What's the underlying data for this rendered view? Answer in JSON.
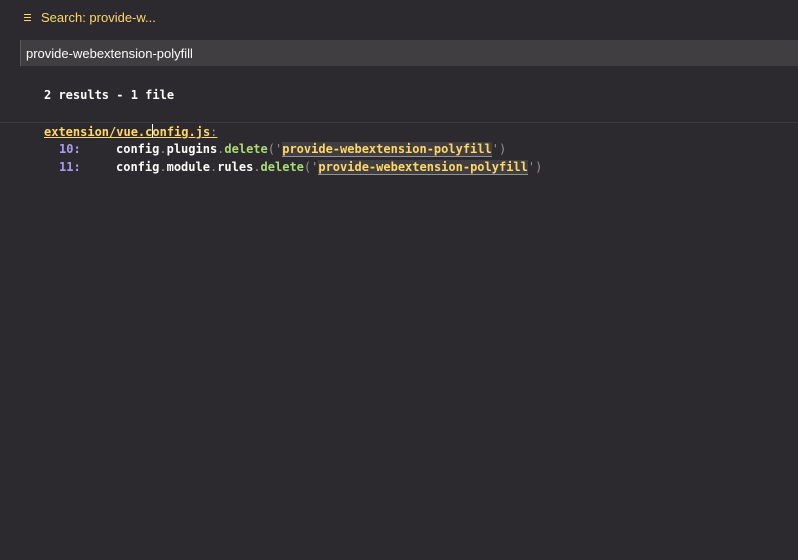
{
  "tab": {
    "title": "Search: provide-w...",
    "accent_color": "#ffd866",
    "icon": "list-icon"
  },
  "search": {
    "query": "provide-webextension-polyfill"
  },
  "results": {
    "summary": "2 results - 1 file",
    "file": {
      "path_before_cursor": "extension/vue.c",
      "path_after_cursor": "onfig.js",
      "colon": ":"
    },
    "lines": [
      {
        "number": "10:",
        "tokens": {
          "t1": "config",
          "t2": ".",
          "t3": "plugins",
          "t4": ".",
          "t5": "delete",
          "t6": "('",
          "match": "provide-webextension-polyfill",
          "t7": "')"
        }
      },
      {
        "number": "11:",
        "tokens": {
          "t1": "config",
          "t2": ".",
          "t3": "module",
          "t4": ".",
          "t5": "rules",
          "t6": ".",
          "t7": "delete",
          "t8": "('",
          "match": "provide-webextension-polyfill",
          "t9": "')"
        }
      }
    ]
  }
}
